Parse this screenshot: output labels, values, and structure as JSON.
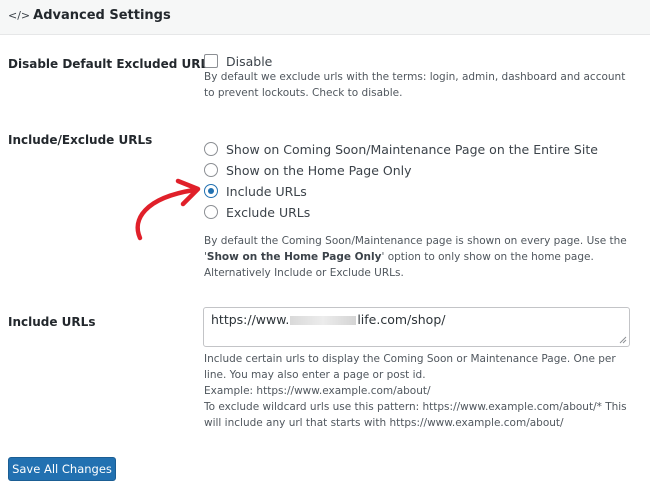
{
  "panel": {
    "icon": "code-icon",
    "title": "Advanced Settings"
  },
  "excluded": {
    "label": "Disable Default Excluded URLs",
    "checkbox_label": "Disable",
    "checked": false,
    "description": "By default we exclude urls with the terms: login, admin, dashboard and account to prevent lockouts. Check to disable."
  },
  "include_exclude": {
    "label": "Include/Exclude URLs",
    "options": [
      {
        "label": "Show on Coming Soon/Maintenance Page on the Entire Site",
        "checked": false
      },
      {
        "label": "Show on the Home Page Only",
        "checked": false
      },
      {
        "label": "Include URLs",
        "checked": true
      },
      {
        "label": "Exclude URLs",
        "checked": false
      }
    ],
    "description_part1": "By default the Coming Soon/Maintenance page is shown on every page. Use the '",
    "description_bold": "Show on the Home Page Only",
    "description_part2": "' option to only show on the home page. Alternatively Include or Exclude URLs."
  },
  "include_urls": {
    "label": "Include URLs",
    "value": "https://www.",
    "value_suffix": "life.com/shop/",
    "help": [
      "Include certain urls to display the Coming Soon or Maintenance Page. One per line. You may also enter a page or post id.",
      "Example: https://www.example.com/about/",
      "To exclude wildcard urls use this pattern: https://www.example.com/about/* This will include any url that starts with https://www.example.com/about/"
    ]
  },
  "actions": {
    "save_label": "Save All Changes"
  },
  "colors": {
    "accent": "#2271b1",
    "annotation": "#e0202a"
  }
}
